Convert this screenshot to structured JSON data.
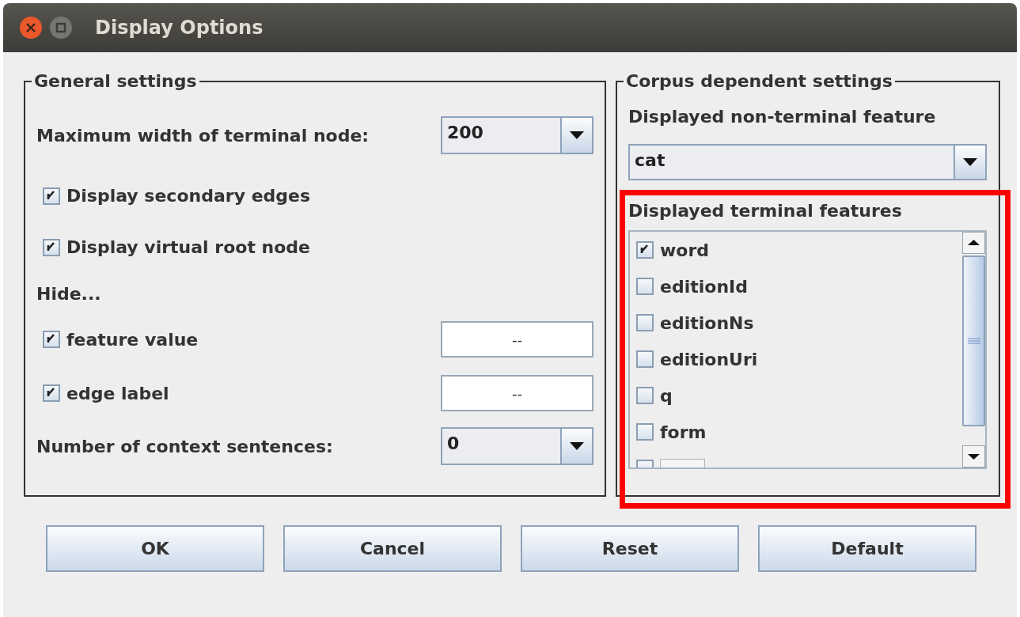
{
  "window": {
    "title": "Display Options"
  },
  "general": {
    "legend": "General settings",
    "max_width": {
      "label": "Maximum width of terminal node:",
      "value": "200"
    },
    "options": [
      {
        "label": "Display secondary edges",
        "checked": true
      },
      {
        "label": "Display virtual root node",
        "checked": true
      }
    ],
    "hide_label": "Hide...",
    "hide_options": [
      {
        "label": "feature value",
        "checked": true,
        "value": "--"
      },
      {
        "label": "edge label",
        "checked": true,
        "value": "--"
      }
    ],
    "context": {
      "label": "Number of context sentences:",
      "value": "0"
    }
  },
  "corpus": {
    "legend": "Corpus dependent settings",
    "nonterminal": {
      "label": "Displayed non-terminal feature",
      "value": "cat"
    },
    "terminal": {
      "label": "Displayed terminal features",
      "highlighted": true,
      "items": [
        {
          "label": "word",
          "checked": true
        },
        {
          "label": "editionId",
          "checked": false
        },
        {
          "label": "editionNs",
          "checked": false
        },
        {
          "label": "editionUri",
          "checked": false
        },
        {
          "label": "q",
          "checked": false
        },
        {
          "label": "form",
          "checked": false
        },
        {
          "checked": false
        }
      ]
    }
  },
  "buttons": [
    "OK",
    "Cancel",
    "Reset",
    "Default"
  ]
}
